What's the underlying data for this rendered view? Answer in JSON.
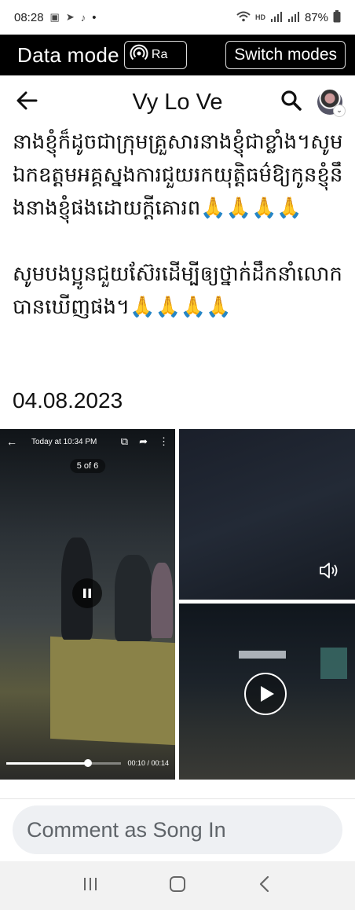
{
  "status_bar": {
    "time": "08:28",
    "dot": "•",
    "battery": "87%",
    "left_icons": [
      "gallery-icon",
      "telegram-icon",
      "tiktok-icon"
    ],
    "right_icons": [
      "wifi-icon",
      "hd-icon",
      "signal-icon",
      "signal-icon",
      "battery-icon"
    ]
  },
  "data_mode": {
    "title": "Data mode",
    "signal_label": "Ra",
    "switch_label": "Switch modes"
  },
  "header": {
    "title": "Vy Lo Ve"
  },
  "post": {
    "text": "នាងខ្ញុំក៏ដូចជាក្រុមគ្រួសារនាងខ្ញុំជាខ្លាំង។សូមឯកឧត្តមអគ្គស្នងការជួយរកយុត្តិធម៌ឱ្យកូនខ្ញុំនឹងនាងខ្ញុំផងដោយក្តីគោរព🙏🙏🙏🙏\n\nសូមបងប្អូនជួយស៊ែរដើម្បីឲ្យថ្នាក់ដឹកនាំលោកបានឃើញផង។🙏🙏🙏🙏",
    "date": "04.08.2023"
  },
  "media": {
    "video": {
      "top_label": "Today at 10:34 PM",
      "counter": "5 of 6",
      "elapsed": "00:10",
      "duration": "00:14",
      "time_display": "00:10 / 00:14",
      "progress": 0.71
    }
  },
  "comment": {
    "placeholder": "Comment as Song In"
  },
  "colors": {
    "data_mode_bg": "#000000",
    "comment_bg": "#eef0f3",
    "nav_bg": "#f2f2f2"
  }
}
